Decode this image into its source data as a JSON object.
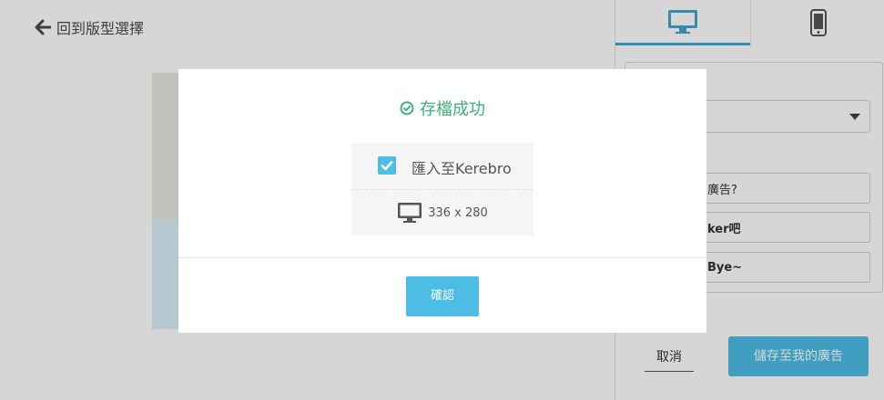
{
  "nav": {
    "back_label": "回到版型選擇"
  },
  "right_panel": {
    "tabs": [
      {
        "name": "desktop",
        "icon": "monitor-icon"
      },
      {
        "name": "mobile",
        "icon": "phone-icon"
      }
    ],
    "fields": [
      {
        "value": "廣告?"
      },
      {
        "value": "ker吧"
      },
      {
        "value": "Bye~"
      }
    ],
    "cancel_label": "取消",
    "save_label": "儲存至我的廣告"
  },
  "modal": {
    "title": "存檔成功",
    "import_label": "匯入至Kerebro",
    "import_checked": true,
    "size_label": "336 x 280",
    "confirm_label": "確認"
  },
  "colors": {
    "accent": "#4dbde6",
    "success": "#3ab27a",
    "tab_indicator": "#3ea7cf"
  }
}
